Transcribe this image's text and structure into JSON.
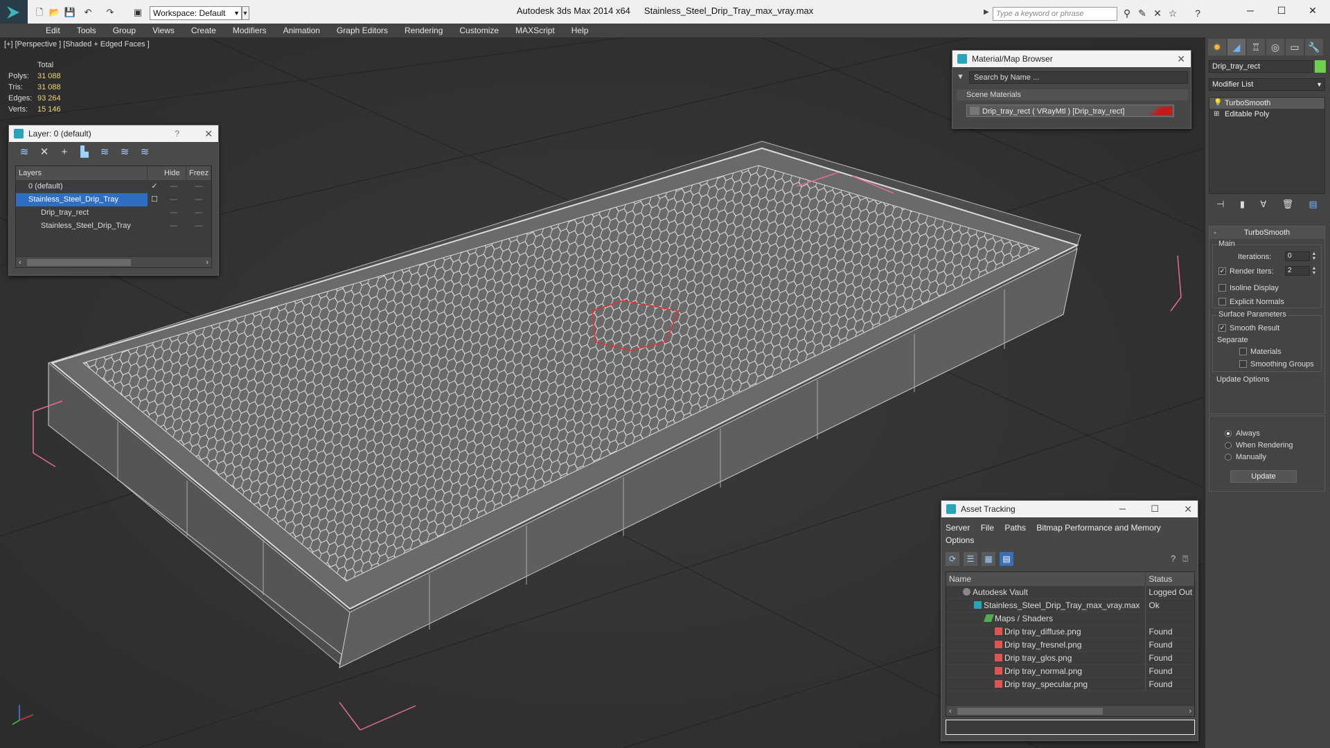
{
  "titlebar": {
    "app_title": "Autodesk 3ds Max  2014 x64",
    "file_name": "Stainless_Steel_Drip_Tray_max_vray.max",
    "workspace": "Workspace: Default",
    "search_placeholder": "Type a keyword or phrase"
  },
  "menu": [
    "Edit",
    "Tools",
    "Group",
    "Views",
    "Create",
    "Modifiers",
    "Animation",
    "Graph Editors",
    "Rendering",
    "Customize",
    "MAXScript",
    "Help"
  ],
  "viewport": {
    "label": "[+] [Perspective ] [Shaded + Edged Faces ]",
    "stats": {
      "header": "Total",
      "rows": [
        {
          "k": "Polys:",
          "v": "31 088"
        },
        {
          "k": "Tris:",
          "v": "31 088"
        },
        {
          "k": "Edges:",
          "v": "93 264"
        },
        {
          "k": "Verts:",
          "v": "15 146"
        }
      ]
    }
  },
  "layer_panel": {
    "title": "Layer: 0 (default)",
    "help": "?",
    "col_layers": "Layers",
    "col_hide": "Hide",
    "col_freeze": "Freez",
    "rows": [
      {
        "name": "0 (default)",
        "check": "✓"
      },
      {
        "name": "Stainless_Steel_Drip_Tray",
        "check": ""
      },
      {
        "name": "Drip_tray_rect",
        "check": ""
      },
      {
        "name": "Stainless_Steel_Drip_Tray",
        "check": ""
      }
    ]
  },
  "material_browser": {
    "title": "Material/Map Browser",
    "search_placeholder": "Search by Name ...",
    "section": "Scene Materials",
    "item": "Drip_tray_rect  ( VRayMtl ) [Drip_tray_rect]"
  },
  "command_panel": {
    "object_name": "Drip_tray_rect",
    "modifier_list": "Modifier List",
    "stack": [
      "TurboSmooth",
      "Editable Poly"
    ],
    "rollout_title": "TurboSmooth",
    "main_label": "Main",
    "iterations_label": "Iterations:",
    "iterations_value": "0",
    "render_iters_label": "Render Iters:",
    "render_iters_value": "2",
    "isoline": "Isoline Display",
    "explicit_normals": "Explicit Normals",
    "surface_params": "Surface Parameters",
    "smooth_result": "Smooth Result",
    "separate": "Separate",
    "materials": "Materials",
    "smoothing_groups": "Smoothing Groups",
    "update_options": "Update Options",
    "always": "Always",
    "when_rendering": "When Rendering",
    "manually": "Manually",
    "update_btn": "Update"
  },
  "asset_tracking": {
    "title": "Asset Tracking",
    "menu": [
      "Server",
      "File",
      "Paths",
      "Bitmap Performance and Memory",
      "Options"
    ],
    "col_name": "Name",
    "col_status": "Status",
    "rows": [
      {
        "name": "Autodesk Vault",
        "status": "Logged Out"
      },
      {
        "name": "Stainless_Steel_Drip_Tray_max_vray.max",
        "status": "Ok"
      },
      {
        "name": "Maps / Shaders",
        "status": ""
      },
      {
        "name": "Drip tray_diffuse.png",
        "status": "Found"
      },
      {
        "name": "Drip tray_fresnel.png",
        "status": "Found"
      },
      {
        "name": "Drip tray_glos.png",
        "status": "Found"
      },
      {
        "name": "Drip tray_normal.png",
        "status": "Found"
      },
      {
        "name": "Drip tray_specular.png",
        "status": "Found"
      }
    ]
  }
}
